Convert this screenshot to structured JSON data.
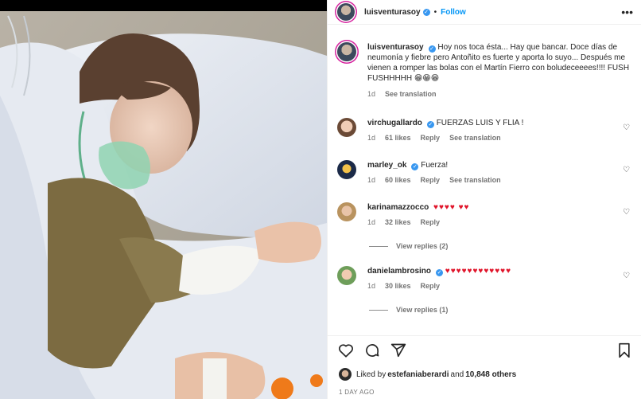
{
  "post": {
    "author": "luisventurasoy",
    "follow_label": "Follow",
    "more_label": "•••",
    "dot": "•",
    "verified_mark": "✓"
  },
  "caption": {
    "username": "luisventurasoy",
    "text": "Hoy nos toca ésta... Hay que bancar. Doce días de neumonía y fiebre pero Antoñito es fuerte y aporta lo suyo... Después me vienen a romper las bolas con el Martín Fierro con boludeceeees!!!! FUSH FUSHHHHH 😁😁😁",
    "time": "1d",
    "translate": "See translation"
  },
  "comments": [
    {
      "username": "virchugallardo",
      "text": "FUERZAS LUIS Y FLIA !",
      "time": "1d",
      "likes": "61 likes",
      "reply": "Reply",
      "translate": "See translation",
      "replies": ""
    },
    {
      "username": "marley_ok",
      "text": "Fuerza!",
      "time": "1d",
      "likes": "60 likes",
      "reply": "Reply",
      "translate": "See translation",
      "replies": ""
    },
    {
      "username": "karinamazzocco",
      "text": "♥♥♥♥ ♥♥",
      "time": "1d",
      "likes": "32 likes",
      "reply": "Reply",
      "translate": "",
      "replies": "View replies (2)"
    },
    {
      "username": "danielambrosino",
      "text": "♥♥♥♥♥♥♥♥♥♥♥♥",
      "time": "1d",
      "likes": "30 likes",
      "reply": "Reply",
      "translate": "",
      "replies": "View replies (1)"
    }
  ],
  "likes": {
    "prefix": "Liked by ",
    "user": "estefaniaberardi",
    "middle": " and ",
    "count": "10,848 others"
  },
  "date": "1 DAY AGO",
  "icons": {
    "like": "heart-icon",
    "comment": "comment-icon",
    "share": "share-icon",
    "save": "bookmark-icon"
  }
}
